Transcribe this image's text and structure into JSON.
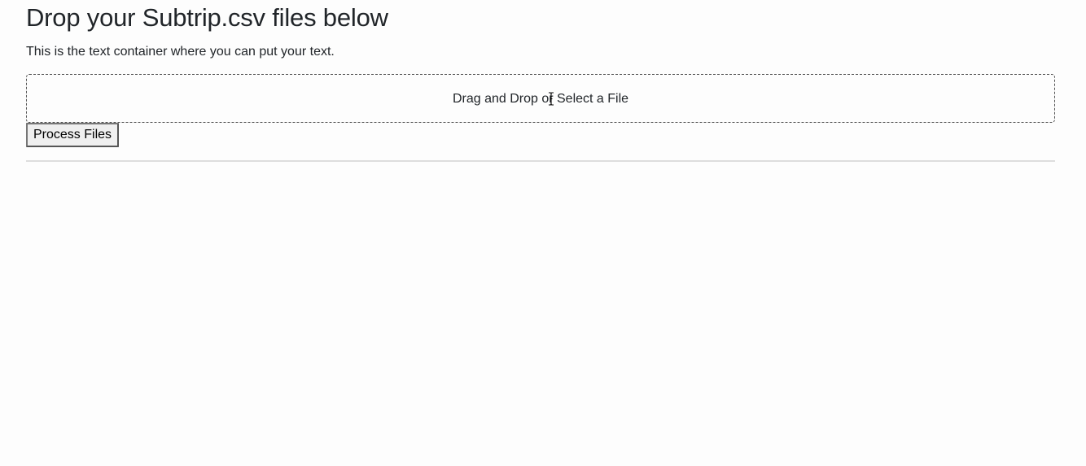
{
  "page": {
    "title": "Drop your Subtrip.csv files below",
    "description": "This is the text container where you can put your text."
  },
  "dropzone": {
    "label": "Drag and Drop or Select a File",
    "cursor_icon": "text-cursor-icon"
  },
  "actions": {
    "process_label": "Process Files"
  },
  "colors": {
    "background": "#fdfdfd",
    "text": "#212529",
    "divider": "#dddddd",
    "button_bg": "#efefef"
  }
}
